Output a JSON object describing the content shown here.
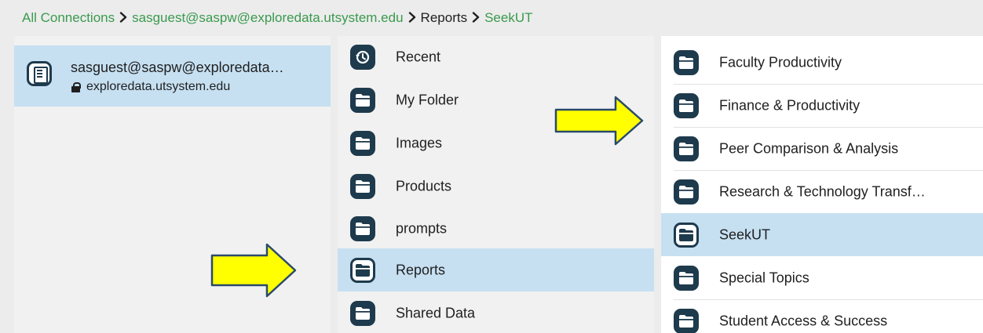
{
  "breadcrumb": {
    "items": [
      {
        "label": "All Connections"
      },
      {
        "label": "sasguest@saspw@exploredata.utsystem.edu"
      },
      {
        "label": "Reports"
      },
      {
        "label": "SeekUT"
      }
    ],
    "link_color": "#3a9a4e"
  },
  "connections": {
    "selected": {
      "name": "sasguest@saspw@exploredata…",
      "host": "exploredata.utsystem.edu",
      "icon": "server-icon"
    }
  },
  "folders": {
    "items": [
      {
        "label": "Recent",
        "icon": "history-icon"
      },
      {
        "label": "My Folder",
        "icon": "folder-icon"
      },
      {
        "label": "Images",
        "icon": "folder-icon"
      },
      {
        "label": "Products",
        "icon": "folder-icon"
      },
      {
        "label": "prompts",
        "icon": "folder-icon"
      },
      {
        "label": "Reports",
        "icon": "folder-icon",
        "selected": true
      },
      {
        "label": "Shared Data",
        "icon": "folder-icon"
      }
    ]
  },
  "reports": {
    "items": [
      {
        "label": "Faculty Productivity",
        "icon": "folder-icon"
      },
      {
        "label": "Finance & Productivity",
        "icon": "folder-icon"
      },
      {
        "label": "Peer Comparison & Analysis",
        "icon": "folder-icon"
      },
      {
        "label": "Research & Technology Transf…",
        "icon": "folder-icon"
      },
      {
        "label": "SeekUT",
        "icon": "folder-icon",
        "selected": true
      },
      {
        "label": "Special Topics",
        "icon": "folder-icon"
      },
      {
        "label": "Student Access & Success",
        "icon": "folder-icon"
      }
    ]
  },
  "colors": {
    "selection": "#c6e0f2",
    "icon_fill": "#1e3a4d",
    "arrow_fill": "#ffff00",
    "arrow_stroke": "#2a4a6a"
  }
}
